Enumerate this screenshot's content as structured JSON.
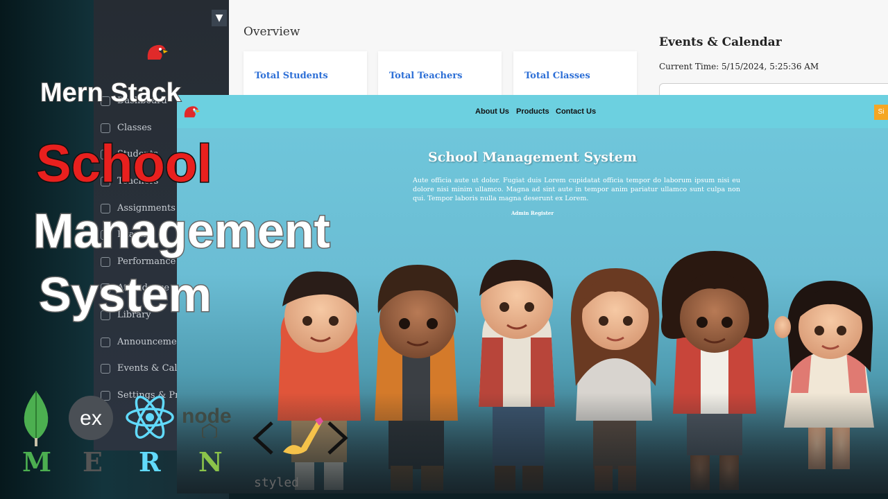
{
  "sidebar": {
    "toggle_glyph": "▼",
    "items": [
      {
        "label": "Dashboard"
      },
      {
        "label": "Classes"
      },
      {
        "label": "Students"
      },
      {
        "label": "Teachers"
      },
      {
        "label": "Assignments"
      },
      {
        "label": "Exams"
      },
      {
        "label": "Performance"
      },
      {
        "label": "Attendance"
      },
      {
        "label": "Library"
      },
      {
        "label": "Announcements"
      },
      {
        "label": "Events & Calendar"
      },
      {
        "label": "Settings & Profile"
      }
    ]
  },
  "dashboard": {
    "overview_title": "Overview",
    "cards": [
      {
        "label": "Total Students"
      },
      {
        "label": "Total Teachers"
      },
      {
        "label": "Total Classes"
      }
    ],
    "events_title": "Events & Calendar",
    "current_time": "Current Time: 5/15/2024, 5:25:36 AM"
  },
  "landing": {
    "nav": {
      "about": "About Us",
      "products": "Products",
      "contact": "Contact Us",
      "signin": "Si"
    },
    "title": "School Management System",
    "description": "Aute officia aute ut dolor. Fugiat duis Lorem cupidatat officia tempor do laborum ipsum nisi eu dolore nisi minim ullamco. Magna ad sint aute in tempor anim pariatur ullamco sunt culpa non qui. Tempor laboris nulla magna deserunt ex Lorem.",
    "admin_link": "Admin Register"
  },
  "overlay": {
    "line1": "Mern Stack",
    "line2": "School",
    "line3": "Management",
    "line4": "System"
  },
  "logos": {
    "m": "M",
    "e": "E",
    "r": "R",
    "n": "N",
    "express_text": "ex",
    "node_text": "node",
    "styled_text": "styled"
  },
  "colors": {
    "school_red": "#e8201e",
    "card_blue": "#2d6fd6",
    "landing_nav": "#6cd0e0",
    "signin_orange": "#f5a623",
    "mongo_green": "#4caf50",
    "react_blue": "#61dafb"
  }
}
